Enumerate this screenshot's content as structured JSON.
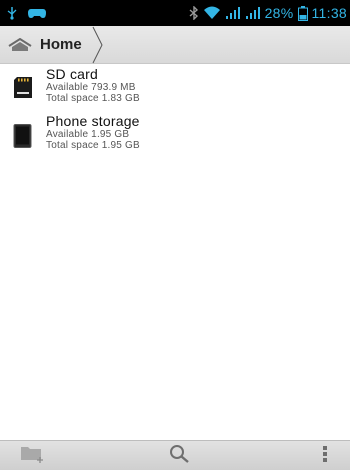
{
  "status_bar": {
    "battery_percent": "28%",
    "time": "11:38",
    "icons": [
      "usb-debug-icon",
      "gamepad-icon",
      "bluetooth-icon",
      "wifi-icon",
      "signal-icon",
      "signal-icon",
      "battery-icon"
    ],
    "accent_color": "#33b5e5"
  },
  "breadcrumb": {
    "home_label": "Home",
    "home_icon": "home-icon"
  },
  "storage_list": [
    {
      "name": "SD card",
      "available": "Available 793.9 MB",
      "total": "Total space 1.83 GB",
      "icon": "sd-card-icon"
    },
    {
      "name": "Phone storage",
      "available": "Available 1.95 GB",
      "total": "Total space 1.95 GB",
      "icon": "phone-storage-icon"
    }
  ],
  "bottom_bar": {
    "icons": [
      "new-folder-icon",
      "search-icon",
      "overflow-menu-icon"
    ]
  }
}
